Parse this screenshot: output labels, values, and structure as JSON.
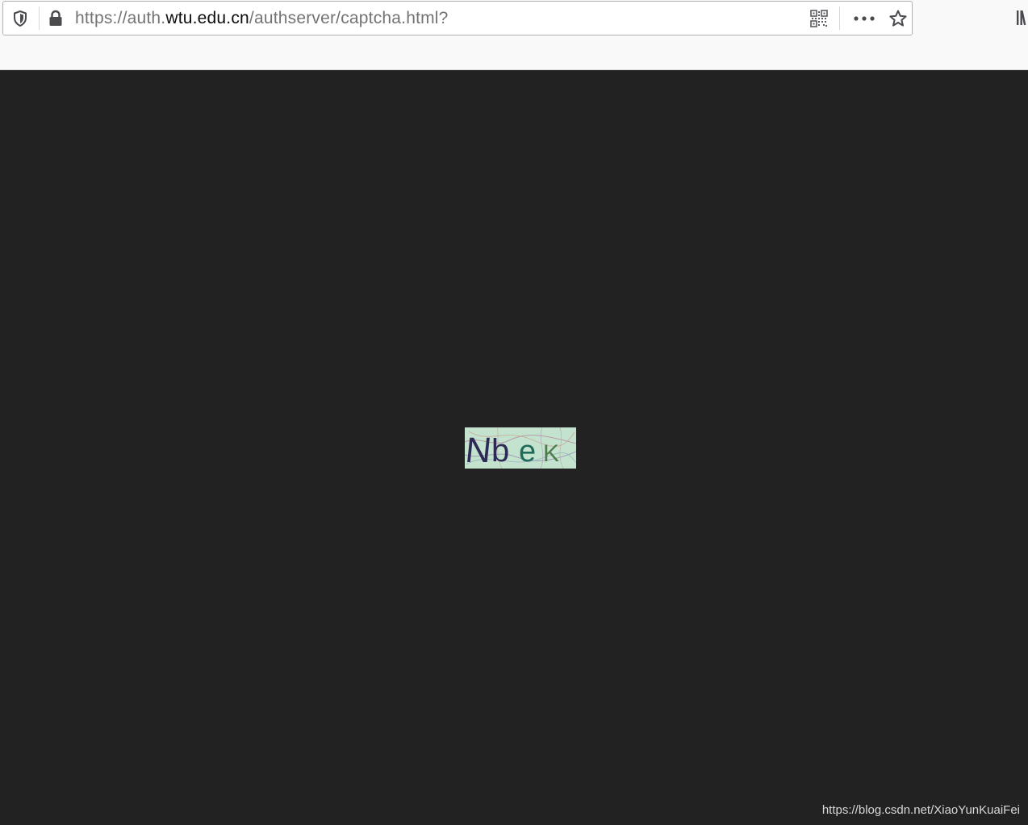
{
  "urlbar": {
    "url_prefix": "https://auth.",
    "url_host": "wtu.edu.cn",
    "url_path": "/authserver/captcha.html?"
  },
  "icons": {
    "tracking_protection": "shield-icon",
    "site_security": "lock-icon",
    "qr_code": "qr-code-icon",
    "page_actions": "more-icon",
    "bookmark": "star-icon",
    "library": "library-icon"
  },
  "page": {
    "background_color": "#222222",
    "captcha_image": {
      "chars": [
        "N",
        "b",
        "e",
        "K"
      ],
      "background_color": "#c4e3cf"
    }
  },
  "watermark": {
    "text": "https://blog.csdn.net/XiaoYunKuaiFei"
  }
}
